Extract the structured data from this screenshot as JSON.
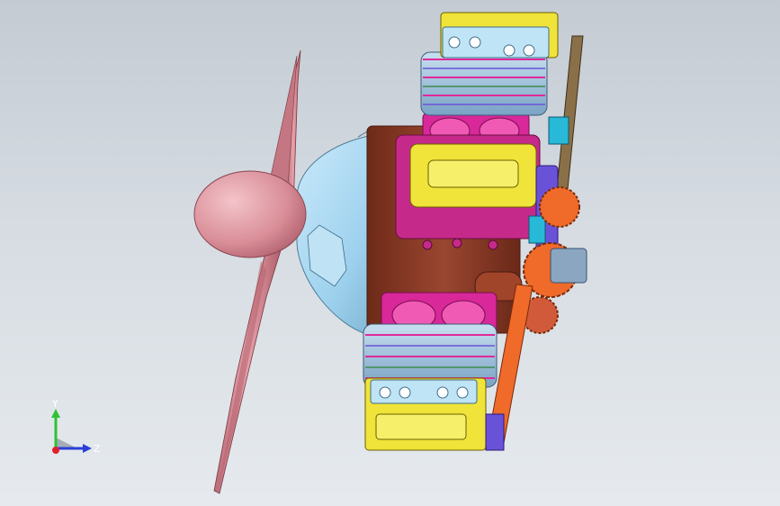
{
  "viewport": {
    "background_top": "#c4cbd3",
    "background_bottom": "#e6eaee"
  },
  "model": {
    "propeller_color": "#d98e98",
    "spinner_color": "#d98e98",
    "cowl_color": "#a9d8f0",
    "crankcase_color": "#8b3a24",
    "cylinder_head_color": "#f0e33a",
    "cylinder_base_color": "#e0309a",
    "cooling_fin_color": "#8fb8d8",
    "gear_color": "#f06a2a",
    "pushrod_color": "#8a7048",
    "accessory_color": "#6a52d8"
  },
  "triad": {
    "y_label": "Y",
    "z_label": "Z",
    "y_color": "#2ec234",
    "z_color": "#2a3fd8",
    "x_color": "#e0202a"
  }
}
